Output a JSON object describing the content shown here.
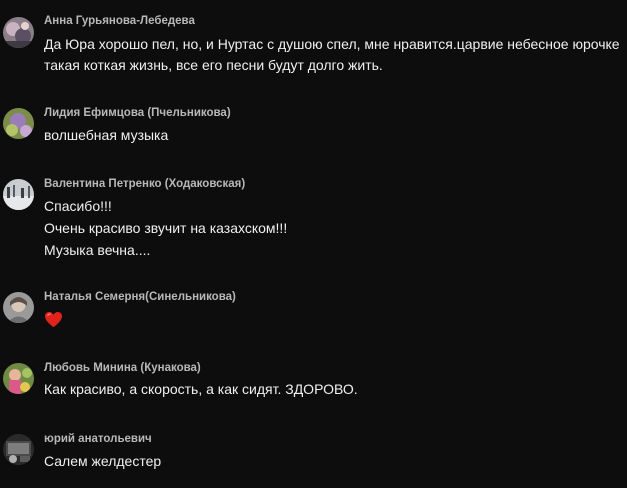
{
  "comments": [
    {
      "author": "Анна Гурьянова-Лебедева",
      "lines": [
        "Да Юра хорошо пел, но, и Нуртас с душою спел, мне нравится.царвие небесное юрочке",
        "такая коткая жизнь, все его песни будут долго жить."
      ]
    },
    {
      "author": "Лидия Ефимцова (Пчельникова)",
      "lines": [
        "волшебная музыка"
      ]
    },
    {
      "author": "Валентина Петренко (Ходаковская)",
      "lines": [
        "Спасибо!!!",
        "Очень красиво звучит на казахском!!!",
        "Музыка вечна...."
      ]
    },
    {
      "author": "Наталья Семерня(Синельникова)",
      "emoji": "red-heart-icon"
    },
    {
      "author": "Любовь Минина (Кунакова)",
      "lines": [
        "Как красиво, а скорость, а как сидят. ЗДОРОВО."
      ]
    },
    {
      "author": "юрий анатольевич",
      "lines": [
        "Салем желдестер"
      ]
    }
  ],
  "colors": {
    "background": "#0d0d0d",
    "author": "#b8b8b8",
    "text": "#f0f0f0",
    "heart": "#e0241b"
  }
}
